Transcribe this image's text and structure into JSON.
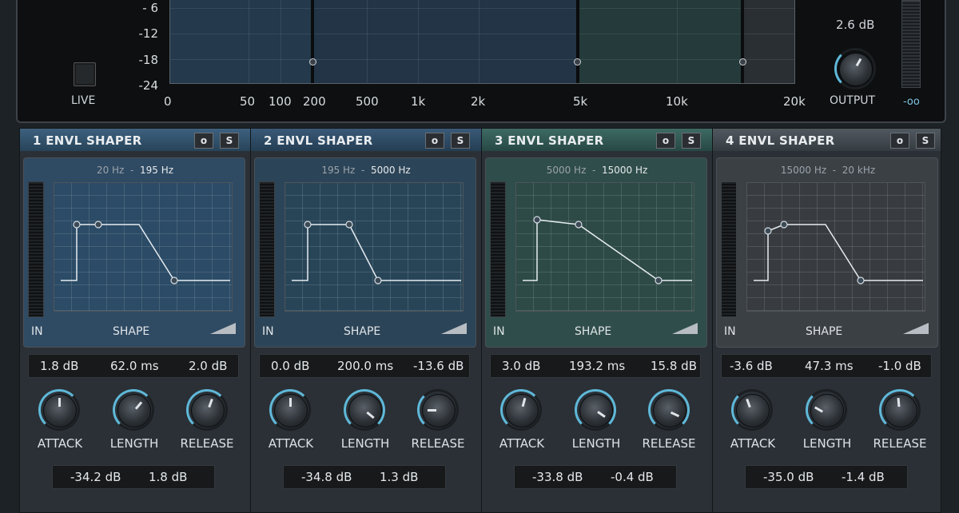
{
  "top": {
    "y_ticks": [
      "- 6",
      "-12",
      "-18",
      "-24"
    ],
    "x_ticks": [
      "0",
      "50",
      "100",
      "200",
      "500",
      "1k",
      "2k",
      "5k",
      "10k",
      "20k"
    ],
    "live_label": "LIVE",
    "output_value": "2.6 dB",
    "output_label": "OUTPUT",
    "meter_label": "-oo"
  },
  "colors": {
    "band1": "#2f4a63",
    "band2": "#2f4a63",
    "band3": "#2f4d4a",
    "band4": "#3b4045"
  },
  "bands": [
    {
      "title": "1  ENVL SHAPER",
      "freq_lo": "20 Hz",
      "freq_sep": "-",
      "freq_hi": "195 Hz",
      "in_label": "IN",
      "shape_label": "SHAPE",
      "attack_val": "1.8 dB",
      "length_val": "62.0 ms",
      "release_val": "2.0 dB",
      "attack_label": "ATTACK",
      "length_label": "LENGTH",
      "release_label": "RELEASE",
      "extra1": "-34.2 dB",
      "extra2": "1.8 dB",
      "btn_o": "o",
      "btn_s": "S"
    },
    {
      "title": "2  ENVL SHAPER",
      "freq_lo": "195 Hz",
      "freq_sep": "-",
      "freq_hi": "5000 Hz",
      "in_label": "IN",
      "shape_label": "SHAPE",
      "attack_val": "0.0 dB",
      "length_val": "200.0 ms",
      "release_val": "-13.6 dB",
      "attack_label": "ATTACK",
      "length_label": "LENGTH",
      "release_label": "RELEASE",
      "extra1": "-34.8 dB",
      "extra2": "1.3 dB",
      "btn_o": "o",
      "btn_s": "S"
    },
    {
      "title": "3  ENVL SHAPER",
      "freq_lo": "5000 Hz",
      "freq_sep": "-",
      "freq_hi": "15000 Hz",
      "in_label": "IN",
      "shape_label": "SHAPE",
      "attack_val": "3.0 dB",
      "length_val": "193.2 ms",
      "release_val": "15.8 dB",
      "attack_label": "ATTACK",
      "length_label": "LENGTH",
      "release_label": "RELEASE",
      "extra1": "-33.8 dB",
      "extra2": "-0.4 dB",
      "btn_o": "o",
      "btn_s": "S"
    },
    {
      "title": "4  ENVL SHAPER",
      "freq_lo": "15000 Hz",
      "freq_sep": "-",
      "freq_hi": "20 kHz",
      "in_label": "IN",
      "shape_label": "SHAPE",
      "attack_val": "-3.6 dB",
      "length_val": "47.3 ms",
      "release_val": "-1.0 dB",
      "attack_label": "ATTACK",
      "length_label": "LENGTH",
      "release_label": "RELEASE",
      "extra1": "-35.0 dB",
      "extra2": "-1.4 dB",
      "btn_o": "o",
      "btn_s": "S"
    }
  ]
}
